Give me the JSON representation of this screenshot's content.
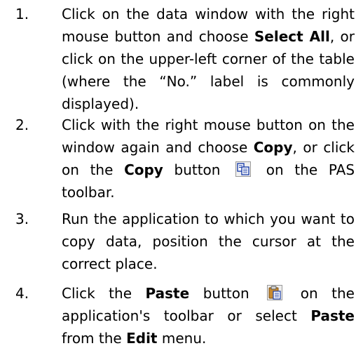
{
  "steps": [
    {
      "number": "1.",
      "parts": {
        "a": "Click on the data window with the right mouse button and choose ",
        "b": "Select All",
        "c": ", or click on the upper-left corner of the table (where the “No.” label is commonly displayed)."
      }
    },
    {
      "number": "2.",
      "parts": {
        "a": "Click with the right mouse button on the window again and choose ",
        "b": "Copy",
        "c": ", or click on the ",
        "d": "Copy",
        "e": " button ",
        "f": " on the PAS toolbar."
      },
      "icon": "copy-icon"
    },
    {
      "number": "3.",
      "parts": {
        "a": "Run the application to which you want to copy data, position the cursor at the correct place."
      }
    },
    {
      "number": "4.",
      "parts": {
        "a": "Click the ",
        "b": "Paste",
        "c": " button ",
        "d": " on the application's toolbar or select ",
        "e": "Paste",
        "f": " from the ",
        "g": "Edit",
        "h": " menu."
      },
      "icon": "paste-icon"
    }
  ]
}
